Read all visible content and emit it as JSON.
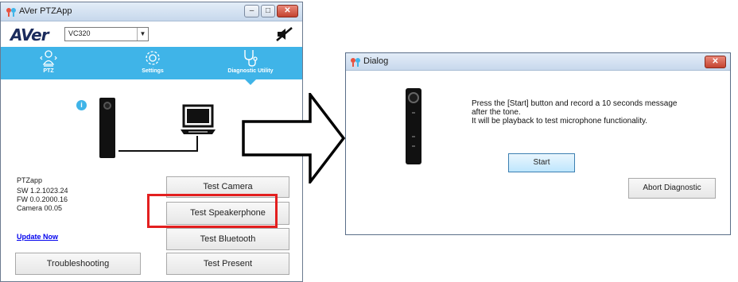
{
  "ptzapp": {
    "title": "AVer PTZApp",
    "window_buttons": {
      "minimize": "–",
      "maximize": "□",
      "close": "✕"
    },
    "logo": "AVer",
    "model": "VC320",
    "nav": [
      {
        "label": "PTZ",
        "icon": "ptz-camera-icon"
      },
      {
        "label": "Settings",
        "icon": "gear-icon"
      },
      {
        "label": "Diagnostic Utility",
        "icon": "stethoscope-icon"
      }
    ],
    "info_icon": "i",
    "device_info": {
      "app": "PTZapp",
      "sw": "SW 1.2.1023.24",
      "fw": "FW 0.0.2000.16",
      "camera": "Camera 00.05"
    },
    "update_link": "Update Now",
    "buttons": {
      "test_camera": "Test Camera",
      "test_speakerphone": "Test Speakerphone",
      "test_bluetooth": "Test Bluetooth",
      "test_present": "Test Present",
      "troubleshooting": "Troubleshooting"
    }
  },
  "dialog": {
    "title": "Dialog",
    "close": "✕",
    "message_line1": "Press the [Start] button and record a 10 seconds message",
    "message_line2": "after the tone.",
    "message_line3": "It will be playback to test microphone functionality.",
    "start": "Start",
    "abort": "Abort Diagnostic"
  },
  "colors": {
    "accent": "#3fb4e8",
    "highlight": "#e31f1f",
    "logo": "#1b2b5c"
  }
}
